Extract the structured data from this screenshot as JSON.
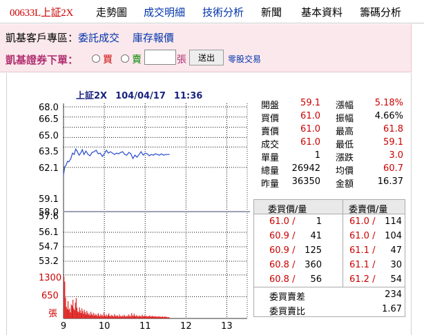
{
  "nav": {
    "items": [
      "00633L上証2X",
      "走勢圖",
      "成交明細",
      "技術分析",
      "新聞",
      "基本資料",
      "籌碼分析"
    ]
  },
  "panel": {
    "zone_label": "凱基客戶專區：",
    "link_entrust": "委託成交",
    "link_inventory": "庫存報價",
    "order_title": "凱基證券下單：",
    "buy_label": "買",
    "sell_label": "賣",
    "qty_value": "",
    "unit_label": "張",
    "submit_label": "送出",
    "oddlot_label": "零股交易"
  },
  "chart_title": {
    "name": "上証2X",
    "date": "104/04/17",
    "time": "11:36"
  },
  "colors": {
    "price_line": "#3355cc",
    "volume_bar": "#dd2222",
    "ref_line": "#9aa0b4",
    "grid": "#000000",
    "red_text": "#cc0000"
  },
  "stats": [
    {
      "l1": "開盤",
      "v1": "59.1",
      "r1": true,
      "l2": "漲幅",
      "v2": "5.18%",
      "r2": true
    },
    {
      "l1": "買價",
      "v1": "61.0",
      "r1": true,
      "l2": "振幅",
      "v2": "4.66%",
      "r2": false
    },
    {
      "l1": "賣價",
      "v1": "61.0",
      "r1": true,
      "l2": "最高",
      "v2": "61.8",
      "r2": true
    },
    {
      "l1": "成交",
      "v1": "61.0",
      "r1": true,
      "l2": "最低",
      "v2": "59.1",
      "r2": true
    },
    {
      "l1": "單量",
      "v1": "1",
      "r1": false,
      "l2": "漲跌",
      "v2": "3.0",
      "r2": true
    },
    {
      "l1": "總量",
      "v1": "26942",
      "r1": false,
      "l2": "均價",
      "v2": "60.7",
      "r2": true
    },
    {
      "l1": "昨量",
      "v1": "36350",
      "r1": false,
      "l2": "金額",
      "v2": "16.37",
      "r2": false
    }
  ],
  "book": {
    "bid_header": "委買價/量",
    "ask_header": "委賣價/量",
    "rows": [
      {
        "bp": "61.0 /",
        "bv": "1",
        "ap": "61.0 /",
        "av": "114"
      },
      {
        "bp": "60.9 /",
        "bv": "41",
        "ap": "61.0 /",
        "av": "104"
      },
      {
        "bp": "60.9 /",
        "bv": "125",
        "ap": "61.1 /",
        "av": "47"
      },
      {
        "bp": "60.8 /",
        "bv": "360",
        "ap": "61.1 /",
        "av": "30"
      },
      {
        "bp": "60.8 /",
        "bv": "56",
        "ap": "61.2 /",
        "av": "54"
      }
    ],
    "diff_label": "委買賣差",
    "diff_value": "234",
    "ratio_label": "委買賣比",
    "ratio_value": "1.67"
  },
  "chart_data": {
    "type": "line",
    "price_axis_ticks": [
      "68.0",
      "66.5",
      "65.0",
      "63.5",
      "62.1",
      "59.1",
      "58.0",
      "57.6",
      "56.1",
      "54.7",
      "53.2"
    ],
    "price_ref": 58.0,
    "volume_axis_ticks": [
      "1300",
      "650",
      "張"
    ],
    "x_ticks": [
      "9",
      "10",
      "11",
      "12",
      "13"
    ],
    "price_series": [
      [
        9.0,
        58.0
      ],
      [
        9.03,
        59.2
      ],
      [
        9.06,
        59.4
      ],
      [
        9.1,
        60.0
      ],
      [
        9.13,
        59.9
      ],
      [
        9.18,
        60.4
      ],
      [
        9.22,
        61.2
      ],
      [
        9.26,
        61.0
      ],
      [
        9.3,
        61.8
      ],
      [
        9.34,
        61.4
      ],
      [
        9.38,
        60.9
      ],
      [
        9.42,
        61.2
      ],
      [
        9.46,
        61.7
      ],
      [
        9.5,
        61.0
      ],
      [
        9.55,
        61.5
      ],
      [
        9.6,
        61.0
      ],
      [
        9.65,
        60.8
      ],
      [
        9.7,
        61.3
      ],
      [
        9.75,
        61.4
      ],
      [
        9.8,
        61.6
      ],
      [
        9.85,
        61.1
      ],
      [
        9.9,
        61.2
      ],
      [
        9.95,
        60.7
      ],
      [
        10.0,
        61.1
      ],
      [
        10.05,
        61.6
      ],
      [
        10.1,
        61.2
      ],
      [
        10.15,
        61.4
      ],
      [
        10.2,
        61.2
      ],
      [
        10.25,
        61.0
      ],
      [
        10.3,
        61.2
      ],
      [
        10.35,
        61.1
      ],
      [
        10.4,
        61.3
      ],
      [
        10.45,
        61.4
      ],
      [
        10.5,
        61.0
      ],
      [
        10.55,
        60.9
      ],
      [
        10.6,
        61.3
      ],
      [
        10.65,
        61.1
      ],
      [
        10.7,
        60.4
      ],
      [
        10.75,
        60.9
      ],
      [
        10.8,
        60.6
      ],
      [
        10.85,
        61.0
      ],
      [
        10.9,
        61.4
      ],
      [
        10.95,
        60.9
      ],
      [
        11.0,
        61.2
      ],
      [
        11.05,
        61.1
      ],
      [
        11.1,
        60.8
      ],
      [
        11.15,
        61.0
      ],
      [
        11.2,
        60.9
      ],
      [
        11.25,
        61.1
      ],
      [
        11.3,
        61.0
      ],
      [
        11.35,
        60.9
      ],
      [
        11.4,
        61.1
      ],
      [
        11.45,
        60.9
      ],
      [
        11.5,
        61.0
      ],
      [
        11.6,
        61.0
      ]
    ],
    "volume_series": [
      [
        9.0,
        1250
      ],
      [
        9.02,
        1100
      ],
      [
        9.04,
        620
      ],
      [
        9.06,
        350
      ],
      [
        9.08,
        280
      ],
      [
        9.1,
        520
      ],
      [
        9.12,
        260
      ],
      [
        9.14,
        300
      ],
      [
        9.16,
        180
      ],
      [
        9.18,
        420
      ],
      [
        9.2,
        380
      ],
      [
        9.22,
        560
      ],
      [
        9.24,
        300
      ],
      [
        9.26,
        250
      ],
      [
        9.28,
        470
      ],
      [
        9.3,
        610
      ],
      [
        9.32,
        320
      ],
      [
        9.34,
        210
      ],
      [
        9.36,
        180
      ],
      [
        9.38,
        330
      ],
      [
        9.4,
        240
      ],
      [
        9.42,
        160
      ],
      [
        9.44,
        300
      ],
      [
        9.46,
        220
      ],
      [
        9.48,
        140
      ],
      [
        9.5,
        260
      ],
      [
        9.52,
        190
      ],
      [
        9.54,
        120
      ],
      [
        9.56,
        230
      ],
      [
        9.58,
        170
      ],
      [
        9.6,
        110
      ],
      [
        9.62,
        150
      ],
      [
        9.64,
        90
      ],
      [
        9.66,
        200
      ],
      [
        9.68,
        130
      ],
      [
        9.7,
        100
      ],
      [
        9.72,
        170
      ],
      [
        9.74,
        80
      ],
      [
        9.76,
        140
      ],
      [
        9.78,
        90
      ],
      [
        9.8,
        120
      ],
      [
        9.82,
        70
      ],
      [
        9.84,
        160
      ],
      [
        9.86,
        100
      ],
      [
        9.88,
        60
      ],
      [
        9.9,
        130
      ],
      [
        9.92,
        80
      ],
      [
        9.94,
        110
      ],
      [
        9.96,
        60
      ],
      [
        9.98,
        180
      ],
      [
        10.0,
        90
      ],
      [
        10.02,
        70
      ],
      [
        10.04,
        120
      ],
      [
        10.06,
        60
      ],
      [
        10.08,
        100
      ],
      [
        10.1,
        150
      ],
      [
        10.12,
        80
      ],
      [
        10.14,
        60
      ],
      [
        10.16,
        110
      ],
      [
        10.18,
        70
      ],
      [
        10.2,
        90
      ],
      [
        10.22,
        50
      ],
      [
        10.24,
        130
      ],
      [
        10.26,
        80
      ],
      [
        10.28,
        60
      ],
      [
        10.3,
        100
      ],
      [
        10.32,
        70
      ],
      [
        10.34,
        50
      ],
      [
        10.36,
        120
      ],
      [
        10.38,
        60
      ],
      [
        10.4,
        80
      ],
      [
        10.42,
        50
      ],
      [
        10.44,
        90
      ],
      [
        10.46,
        60
      ],
      [
        10.48,
        110
      ],
      [
        10.5,
        70
      ],
      [
        10.52,
        50
      ],
      [
        10.54,
        80
      ],
      [
        10.56,
        60
      ],
      [
        10.58,
        120
      ],
      [
        10.6,
        70
      ],
      [
        10.62,
        90
      ],
      [
        10.64,
        50
      ],
      [
        10.66,
        160
      ],
      [
        10.68,
        90
      ],
      [
        10.7,
        70
      ],
      [
        10.72,
        140
      ],
      [
        10.74,
        80
      ],
      [
        10.76,
        60
      ],
      [
        10.78,
        100
      ],
      [
        10.8,
        70
      ],
      [
        10.82,
        50
      ],
      [
        10.84,
        90
      ],
      [
        10.86,
        60
      ],
      [
        10.88,
        80
      ],
      [
        10.9,
        50
      ],
      [
        10.92,
        110
      ],
      [
        10.94,
        70
      ],
      [
        10.96,
        60
      ],
      [
        10.98,
        90
      ],
      [
        11.0,
        60
      ],
      [
        11.02,
        80
      ],
      [
        11.04,
        50
      ],
      [
        11.06,
        70
      ],
      [
        11.08,
        60
      ],
      [
        11.1,
        90
      ],
      [
        11.12,
        50
      ],
      [
        11.14,
        70
      ],
      [
        11.16,
        60
      ],
      [
        11.18,
        80
      ],
      [
        11.2,
        50
      ],
      [
        11.22,
        60
      ],
      [
        11.24,
        70
      ],
      [
        11.26,
        50
      ],
      [
        11.28,
        60
      ],
      [
        11.3,
        40
      ],
      [
        11.32,
        70
      ],
      [
        11.34,
        50
      ],
      [
        11.36,
        60
      ],
      [
        11.38,
        40
      ],
      [
        11.4,
        50
      ],
      [
        11.42,
        60
      ],
      [
        11.44,
        40
      ],
      [
        11.46,
        50
      ],
      [
        11.48,
        60
      ],
      [
        11.5,
        40
      ],
      [
        11.52,
        50
      ],
      [
        11.54,
        30
      ],
      [
        11.56,
        40
      ],
      [
        11.58,
        30
      ]
    ],
    "x_range": [
      9.0,
      13.5
    ],
    "price_range": [
      52.5,
      68.5
    ],
    "volume_range": [
      0,
      1400
    ],
    "grid": true
  }
}
